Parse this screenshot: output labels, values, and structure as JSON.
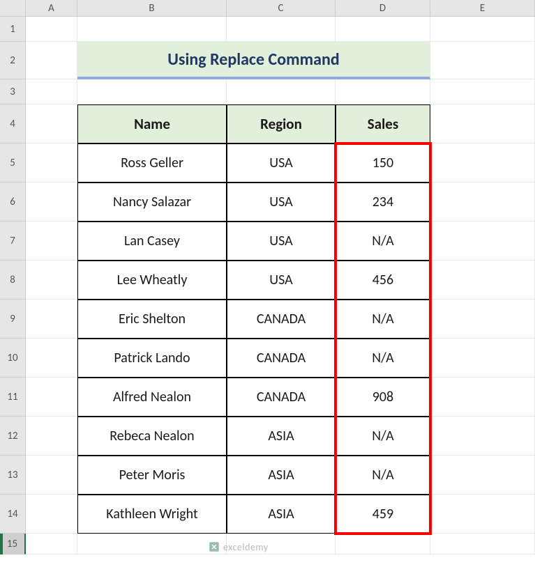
{
  "columns": {
    "A": "A",
    "B": "B",
    "C": "C",
    "D": "D",
    "E": "E"
  },
  "row_labels": [
    "1",
    "2",
    "3",
    "4",
    "5",
    "6",
    "7",
    "8",
    "9",
    "10",
    "11",
    "12",
    "13",
    "14",
    "15"
  ],
  "title": "Using Replace Command",
  "headers": {
    "name": "Name",
    "region": "Region",
    "sales": "Sales"
  },
  "rows": [
    {
      "name": "Ross Geller",
      "region": "USA",
      "sales": "150"
    },
    {
      "name": "Nancy Salazar",
      "region": "USA",
      "sales": "234"
    },
    {
      "name": "Lan Casey",
      "region": "USA",
      "sales": "N/A"
    },
    {
      "name": "Lee Wheatly",
      "region": "USA",
      "sales": "456"
    },
    {
      "name": "Eric Shelton",
      "region": "CANADA",
      "sales": "N/A"
    },
    {
      "name": "Patrick Lando",
      "region": "CANADA",
      "sales": "N/A"
    },
    {
      "name": "Alfred Nealon",
      "region": "CANADA",
      "sales": "908"
    },
    {
      "name": "Rebeca Nealon",
      "region": "ASIA",
      "sales": "N/A"
    },
    {
      "name": "Peter Moris",
      "region": "ASIA",
      "sales": "N/A"
    },
    {
      "name": "Kathleen Wright",
      "region": "ASIA",
      "sales": "459"
    }
  ],
  "watermark": "exceldemy",
  "chart_data": {
    "type": "table",
    "title": "Using Replace Command",
    "columns": [
      "Name",
      "Region",
      "Sales"
    ],
    "rows": [
      [
        "Ross Geller",
        "USA",
        "150"
      ],
      [
        "Nancy Salazar",
        "USA",
        "234"
      ],
      [
        "Lan Casey",
        "USA",
        "N/A"
      ],
      [
        "Lee Wheatly",
        "USA",
        "456"
      ],
      [
        "Eric Shelton",
        "CANADA",
        "N/A"
      ],
      [
        "Patrick Lando",
        "CANADA",
        "N/A"
      ],
      [
        "Alfred Nealon",
        "CANADA",
        "908"
      ],
      [
        "Rebeca Nealon",
        "ASIA",
        "N/A"
      ],
      [
        "Peter Moris",
        "ASIA",
        "N/A"
      ],
      [
        "Kathleen Wright",
        "ASIA",
        "459"
      ]
    ]
  }
}
